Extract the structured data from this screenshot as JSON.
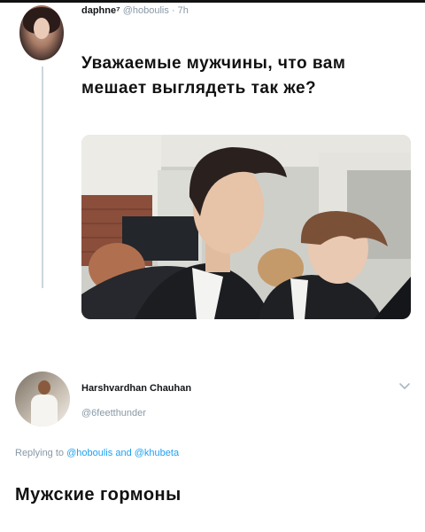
{
  "tweet": {
    "author_name": "daphne⁷",
    "author_handle": "@hoboulis",
    "separator": "·",
    "time": "7h",
    "text": "Уважаемые мужчины, что вам мешает выглядеть так же?"
  },
  "reply": {
    "author_name": "Harshvardhan Chauhan",
    "author_handle": "@6feetthunder",
    "replying_prefix": "Replying to",
    "replying_user1": "@hoboulis",
    "replying_and": "and",
    "replying_user2": "@khubeta",
    "menu_icon": "chevron-down-icon"
  },
  "caption": "Мужские гормоны",
  "colors": {
    "link": "#1da1f2",
    "muted": "#8899a6",
    "thread_line": "#ccd6dd"
  }
}
